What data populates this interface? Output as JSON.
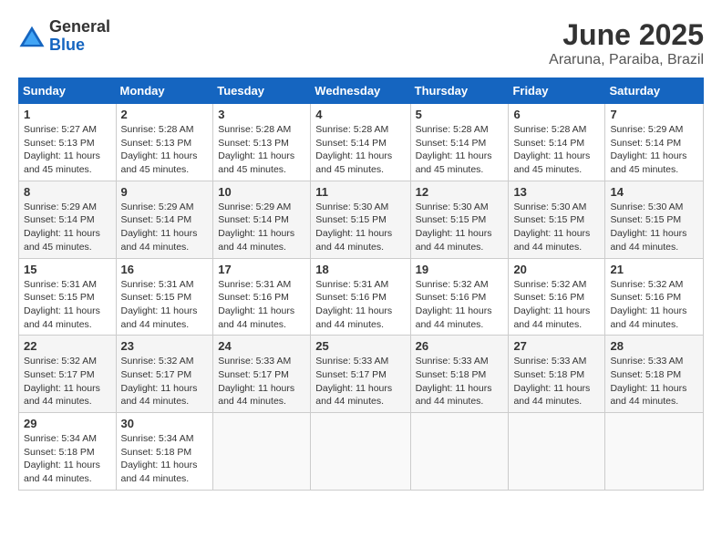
{
  "logo": {
    "general": "General",
    "blue": "Blue"
  },
  "title": {
    "month": "June 2025",
    "location": "Araruna, Paraiba, Brazil"
  },
  "headers": [
    "Sunday",
    "Monday",
    "Tuesday",
    "Wednesday",
    "Thursday",
    "Friday",
    "Saturday"
  ],
  "weeks": [
    [
      {
        "day": "1",
        "sunrise": "5:27 AM",
        "sunset": "5:13 PM",
        "daylight": "11 hours and 45 minutes."
      },
      {
        "day": "2",
        "sunrise": "5:28 AM",
        "sunset": "5:13 PM",
        "daylight": "11 hours and 45 minutes."
      },
      {
        "day": "3",
        "sunrise": "5:28 AM",
        "sunset": "5:13 PM",
        "daylight": "11 hours and 45 minutes."
      },
      {
        "day": "4",
        "sunrise": "5:28 AM",
        "sunset": "5:14 PM",
        "daylight": "11 hours and 45 minutes."
      },
      {
        "day": "5",
        "sunrise": "5:28 AM",
        "sunset": "5:14 PM",
        "daylight": "11 hours and 45 minutes."
      },
      {
        "day": "6",
        "sunrise": "5:28 AM",
        "sunset": "5:14 PM",
        "daylight": "11 hours and 45 minutes."
      },
      {
        "day": "7",
        "sunrise": "5:29 AM",
        "sunset": "5:14 PM",
        "daylight": "11 hours and 45 minutes."
      }
    ],
    [
      {
        "day": "8",
        "sunrise": "5:29 AM",
        "sunset": "5:14 PM",
        "daylight": "11 hours and 45 minutes."
      },
      {
        "day": "9",
        "sunrise": "5:29 AM",
        "sunset": "5:14 PM",
        "daylight": "11 hours and 44 minutes."
      },
      {
        "day": "10",
        "sunrise": "5:29 AM",
        "sunset": "5:14 PM",
        "daylight": "11 hours and 44 minutes."
      },
      {
        "day": "11",
        "sunrise": "5:30 AM",
        "sunset": "5:15 PM",
        "daylight": "11 hours and 44 minutes."
      },
      {
        "day": "12",
        "sunrise": "5:30 AM",
        "sunset": "5:15 PM",
        "daylight": "11 hours and 44 minutes."
      },
      {
        "day": "13",
        "sunrise": "5:30 AM",
        "sunset": "5:15 PM",
        "daylight": "11 hours and 44 minutes."
      },
      {
        "day": "14",
        "sunrise": "5:30 AM",
        "sunset": "5:15 PM",
        "daylight": "11 hours and 44 minutes."
      }
    ],
    [
      {
        "day": "15",
        "sunrise": "5:31 AM",
        "sunset": "5:15 PM",
        "daylight": "11 hours and 44 minutes."
      },
      {
        "day": "16",
        "sunrise": "5:31 AM",
        "sunset": "5:15 PM",
        "daylight": "11 hours and 44 minutes."
      },
      {
        "day": "17",
        "sunrise": "5:31 AM",
        "sunset": "5:16 PM",
        "daylight": "11 hours and 44 minutes."
      },
      {
        "day": "18",
        "sunrise": "5:31 AM",
        "sunset": "5:16 PM",
        "daylight": "11 hours and 44 minutes."
      },
      {
        "day": "19",
        "sunrise": "5:32 AM",
        "sunset": "5:16 PM",
        "daylight": "11 hours and 44 minutes."
      },
      {
        "day": "20",
        "sunrise": "5:32 AM",
        "sunset": "5:16 PM",
        "daylight": "11 hours and 44 minutes."
      },
      {
        "day": "21",
        "sunrise": "5:32 AM",
        "sunset": "5:16 PM",
        "daylight": "11 hours and 44 minutes."
      }
    ],
    [
      {
        "day": "22",
        "sunrise": "5:32 AM",
        "sunset": "5:17 PM",
        "daylight": "11 hours and 44 minutes."
      },
      {
        "day": "23",
        "sunrise": "5:32 AM",
        "sunset": "5:17 PM",
        "daylight": "11 hours and 44 minutes."
      },
      {
        "day": "24",
        "sunrise": "5:33 AM",
        "sunset": "5:17 PM",
        "daylight": "11 hours and 44 minutes."
      },
      {
        "day": "25",
        "sunrise": "5:33 AM",
        "sunset": "5:17 PM",
        "daylight": "11 hours and 44 minutes."
      },
      {
        "day": "26",
        "sunrise": "5:33 AM",
        "sunset": "5:18 PM",
        "daylight": "11 hours and 44 minutes."
      },
      {
        "day": "27",
        "sunrise": "5:33 AM",
        "sunset": "5:18 PM",
        "daylight": "11 hours and 44 minutes."
      },
      {
        "day": "28",
        "sunrise": "5:33 AM",
        "sunset": "5:18 PM",
        "daylight": "11 hours and 44 minutes."
      }
    ],
    [
      {
        "day": "29",
        "sunrise": "5:34 AM",
        "sunset": "5:18 PM",
        "daylight": "11 hours and 44 minutes."
      },
      {
        "day": "30",
        "sunrise": "5:34 AM",
        "sunset": "5:18 PM",
        "daylight": "11 hours and 44 minutes."
      },
      null,
      null,
      null,
      null,
      null
    ]
  ]
}
